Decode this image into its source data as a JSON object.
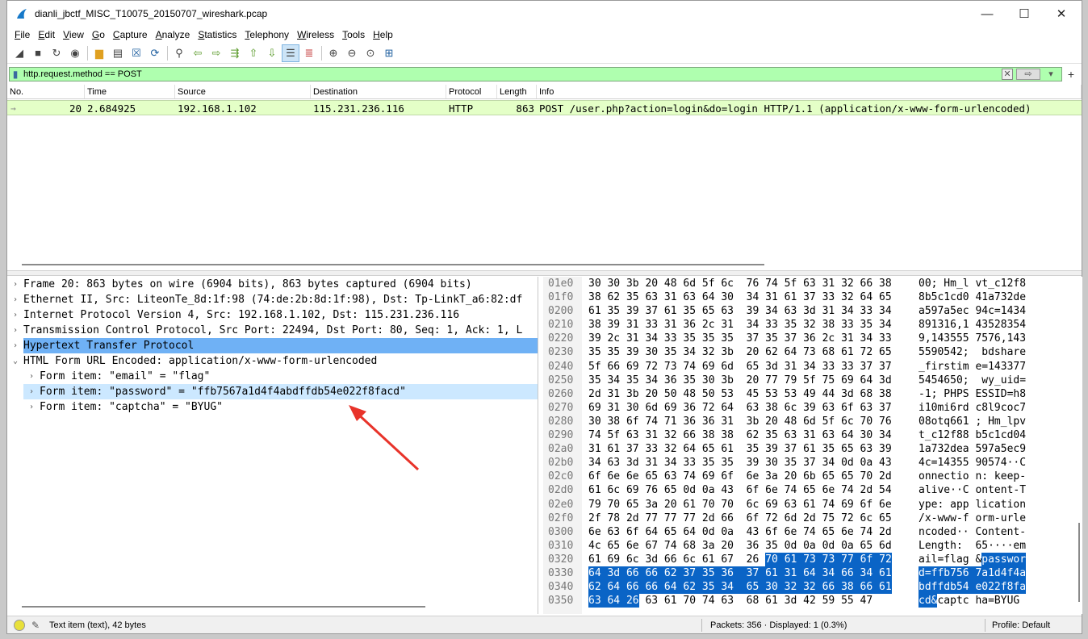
{
  "window": {
    "title": "dianli_jbctf_MISC_T10075_20150707_wireshark.pcap",
    "minimize": "—",
    "maximize": "☐",
    "close": "✕"
  },
  "menu": {
    "items": [
      {
        "label": "File"
      },
      {
        "label": "Edit"
      },
      {
        "label": "View"
      },
      {
        "label": "Go"
      },
      {
        "label": "Capture"
      },
      {
        "label": "Analyze"
      },
      {
        "label": "Statistics"
      },
      {
        "label": "Telephony"
      },
      {
        "label": "Wireless"
      },
      {
        "label": "Tools"
      },
      {
        "label": "Help"
      }
    ]
  },
  "toolbar": {
    "icons": [
      "shark-fin-start-icon",
      "stop-capture-icon",
      "restart-capture-icon",
      "capture-options-icon",
      "open-file-icon",
      "file-set-icon",
      "close-file-icon",
      "reload-file-icon",
      "find-packet-icon",
      "go-back-icon",
      "go-forward-icon",
      "go-to-packet-icon",
      "first-packet-icon",
      "last-packet-icon",
      "autoscroll-icon",
      "colorize-icon",
      "zoom-in-icon",
      "zoom-out-icon",
      "normal-size-icon",
      "resize-columns-icon"
    ]
  },
  "filter": {
    "value": "http.request.method == POST",
    "bg": "#afffaf"
  },
  "packet_list": {
    "columns": [
      "No.",
      "Time",
      "Source",
      "Destination",
      "Protocol",
      "Length",
      "Info"
    ],
    "rows": [
      {
        "no": "20",
        "time": "2.684925",
        "source": "192.168.1.102",
        "destination": "115.231.236.116",
        "protocol": "HTTP",
        "length": "863",
        "info": "POST /user.php?action=login&do=login HTTP/1.1  (application/x-www-form-urlencoded)"
      }
    ]
  },
  "details": {
    "lines": [
      {
        "text": "Frame 20: 863 bytes on wire (6904 bits), 863 bytes captured (6904 bits)",
        "arrow": "›"
      },
      {
        "text": "Ethernet II, Src: LiteonTe_8d:1f:98 (74:de:2b:8d:1f:98), Dst: Tp-LinkT_a6:82:df",
        "arrow": "›"
      },
      {
        "text": "Internet Protocol Version 4, Src: 192.168.1.102, Dst: 115.231.236.116",
        "arrow": "›"
      },
      {
        "text": "Transmission Control Protocol, Src Port: 22494, Dst Port: 80, Seq: 1, Ack: 1, L",
        "arrow": "›"
      },
      {
        "text": "Hypertext Transfer Protocol",
        "arrow": "›"
      },
      {
        "text": "HTML Form URL Encoded: application/x-www-form-urlencoded",
        "arrow": "⌄"
      },
      {
        "text": "Form item: \"email\" = \"flag\"",
        "arrow": "›"
      },
      {
        "text": "Form item: \"password\" = \"ffb7567a1d4f4abdffdb54e022f8facd\"",
        "arrow": "›"
      },
      {
        "text": "Form item: \"captcha\" = \"BYUG\"",
        "arrow": "›"
      }
    ]
  },
  "bytes": {
    "rows": [
      {
        "off": "01e0",
        "hex": "30 30 3b 20 48 6d 5f 6c  76 74 5f 63 31 32 66 38",
        "ascii": "00; Hm_l vt_c12f8"
      },
      {
        "off": "01f0",
        "hex": "38 62 35 63 31 63 64 30  34 31 61 37 33 32 64 65",
        "ascii": "8b5c1cd0 41a732de"
      },
      {
        "off": "0200",
        "hex": "61 35 39 37 61 35 65 63  39 34 63 3d 31 34 33 34",
        "ascii": "a597a5ec 94c=1434"
      },
      {
        "off": "0210",
        "hex": "38 39 31 33 31 36 2c 31  34 33 35 32 38 33 35 34",
        "ascii": "891316,1 43528354"
      },
      {
        "off": "0220",
        "hex": "39 2c 31 34 33 35 35 35  37 35 37 36 2c 31 34 33",
        "ascii": "9,143555 7576,143"
      },
      {
        "off": "0230",
        "hex": "35 35 39 30 35 34 32 3b  20 62 64 73 68 61 72 65",
        "ascii": "5590542;  bdshare"
      },
      {
        "off": "0240",
        "hex": "5f 66 69 72 73 74 69 6d  65 3d 31 34 33 33 37 37",
        "ascii": "_firstim e=143377"
      },
      {
        "off": "0250",
        "hex": "35 34 35 34 36 35 30 3b  20 77 79 5f 75 69 64 3d",
        "ascii": "5454650;  wy_uid="
      },
      {
        "off": "0260",
        "hex": "2d 31 3b 20 50 48 50 53  45 53 53 49 44 3d 68 38",
        "ascii": "-1; PHPS ESSID=h8"
      },
      {
        "off": "0270",
        "hex": "69 31 30 6d 69 36 72 64  63 38 6c 39 63 6f 63 37",
        "ascii": "i10mi6rd c8l9coc7"
      },
      {
        "off": "0280",
        "hex": "30 38 6f 74 71 36 36 31  3b 20 48 6d 5f 6c 70 76",
        "ascii": "08otq661 ; Hm_lpv"
      },
      {
        "off": "0290",
        "hex": "74 5f 63 31 32 66 38 38  62 35 63 31 63 64 30 34",
        "ascii": "t_c12f88 b5c1cd04"
      },
      {
        "off": "02a0",
        "hex": "31 61 37 33 32 64 65 61  35 39 37 61 35 65 63 39",
        "ascii": "1a732dea 597a5ec9"
      },
      {
        "off": "02b0",
        "hex": "34 63 3d 31 34 33 35 35  39 30 35 37 34 0d 0a 43",
        "ascii": "4c=14355 90574··C"
      },
      {
        "off": "02c0",
        "hex": "6f 6e 6e 65 63 74 69 6f  6e 3a 20 6b 65 65 70 2d",
        "ascii": "onnectio n: keep-"
      },
      {
        "off": "02d0",
        "hex": "61 6c 69 76 65 0d 0a 43  6f 6e 74 65 6e 74 2d 54",
        "ascii": "alive··C ontent-T"
      },
      {
        "off": "02e0",
        "hex": "79 70 65 3a 20 61 70 70  6c 69 63 61 74 69 6f 6e",
        "ascii": "ype: app lication"
      },
      {
        "off": "02f0",
        "hex": "2f 78 2d 77 77 77 2d 66  6f 72 6d 2d 75 72 6c 65",
        "ascii": "/x-www-f orm-urle"
      },
      {
        "off": "0300",
        "hex": "6e 63 6f 64 65 64 0d 0a  43 6f 6e 74 65 6e 74 2d",
        "ascii": "ncoded·· Content-"
      },
      {
        "off": "0310",
        "hex": "4c 65 6e 67 74 68 3a 20  36 35 0d 0a 0d 0a 65 6d",
        "ascii": "Length:  65····em"
      },
      {
        "off": "0320",
        "hex_plain": "61 69 6c 3d 66 6c 61 67  26 ",
        "hex_hl": "70 61 73 73 77 6f 72",
        "ascii_plain": "ail=flag &",
        "ascii_hl": "passwor"
      },
      {
        "off": "0330",
        "hex_plain": "",
        "hex_hl": "64 3d 66 66 62 37 35 36  37 61 31 64 34 66 34 61",
        "ascii_plain": "",
        "ascii_hl": "d=ffb756 7a1d4f4a"
      },
      {
        "off": "0340",
        "hex_plain": "",
        "hex_hl": "62 64 66 66 64 62 35 34  65 30 32 32 66 38 66 61",
        "ascii_plain": "",
        "ascii_hl": "bdffdb54 e022f8fa"
      },
      {
        "off": "0350",
        "hex_hl": "63 64 26",
        "hex_tail": " 63 61 70 74 63  68 61 3d 42 59 55 47",
        "ascii_hl": "cd&",
        "ascii_tail": "captc ha=BYUG"
      }
    ]
  },
  "status": {
    "left": "Text item (text), 42 bytes",
    "packets": "Packets: 356 · Displayed: 1 (0.3%)",
    "profile": "Profile: Default"
  }
}
